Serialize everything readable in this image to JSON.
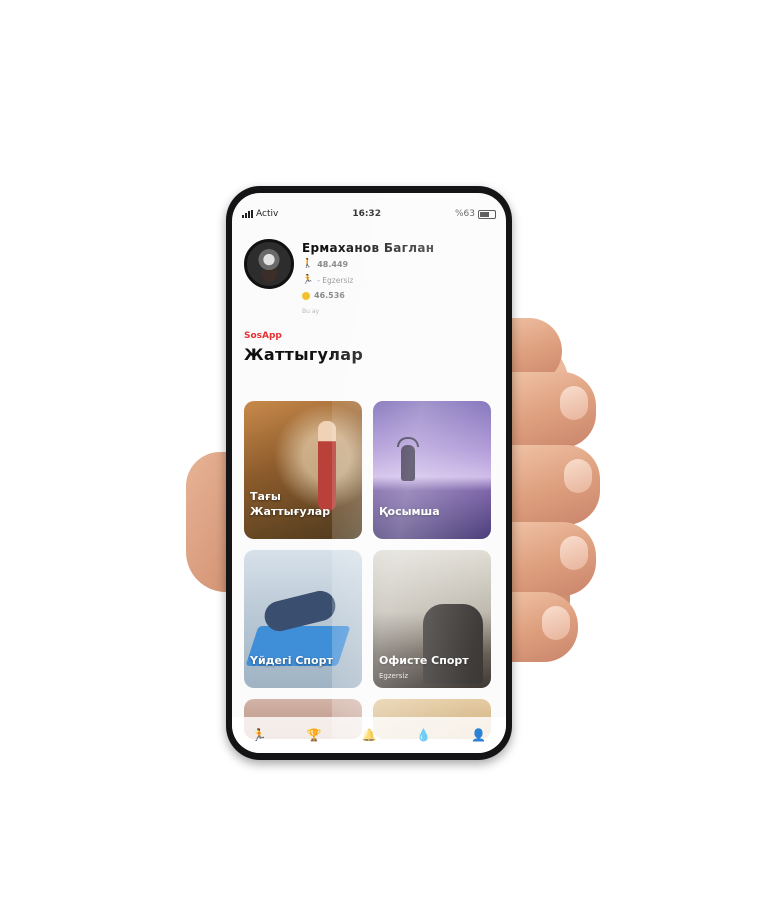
{
  "status_bar": {
    "carrier": "Activ",
    "time": "16:32",
    "battery": "%63"
  },
  "profile": {
    "name": "Ермаханов Баглан",
    "steps": "48.449",
    "activity": "- Egzersiz",
    "coins": "46.536",
    "period": "Bu ay"
  },
  "app_label": "SosApp",
  "page_title": "Жаттыгулар",
  "cards": [
    {
      "label": "Тағы\nЖаттығулар",
      "line1": "Тағы",
      "line2": "Жаттығулар"
    },
    {
      "label": "Қосымша"
    },
    {
      "label": "Үйдегі Спорт"
    },
    {
      "label": "Офисте Спорт",
      "subtitle": "Egzersiz"
    }
  ],
  "colors": {
    "accent": "#e63232",
    "walk_icon": "#e4405a",
    "run_icon": "#3aa56a",
    "coin": "#f2c12e"
  },
  "icons": [
    "walk-icon",
    "run-icon",
    "coin-icon",
    "running-nav-icon",
    "trophy-nav-icon",
    "water-nav-icon",
    "profile-nav-icon"
  ]
}
